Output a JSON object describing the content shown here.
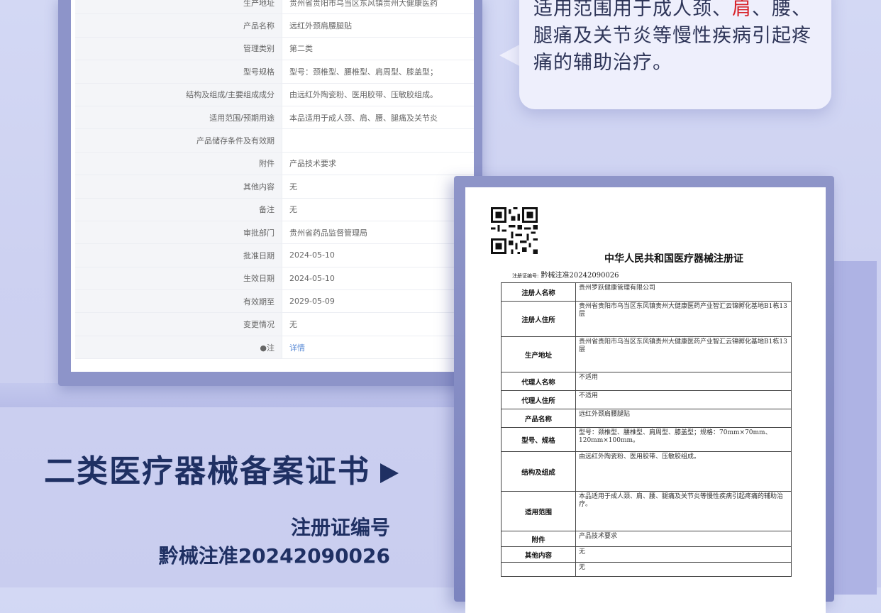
{
  "record_table": {
    "rows": [
      {
        "label": "生产地址",
        "value": "贵州省贵阳市乌当区东风镇贵州大健康医药"
      },
      {
        "label": "产品名称",
        "value": "远红外颈肩腰腿贴"
      },
      {
        "label": "管理类别",
        "value": "第二类"
      },
      {
        "label": "型号规格",
        "value": "型号：颈椎型、腰椎型、肩周型、膝盖型；"
      },
      {
        "label": "结构及组成/主要组成成分",
        "value": "由远红外陶瓷粉、医用胶带、压敏胶组成。"
      },
      {
        "label": "适用范围/预期用途",
        "value": "本品适用于成人颈、肩、腰、腿痛及关节炎"
      },
      {
        "label": "产品储存条件及有效期",
        "value": ""
      },
      {
        "label": "附件",
        "value": "产品技术要求"
      },
      {
        "label": "其他内容",
        "value": "无"
      },
      {
        "label": "备注",
        "value": "无"
      },
      {
        "label": "审批部门",
        "value": "贵州省药品监督管理局"
      },
      {
        "label": "批准日期",
        "value": "2024-05-10"
      },
      {
        "label": "生效日期",
        "value": "2024-05-10"
      },
      {
        "label": "有效期至",
        "value": "2029-05-09"
      },
      {
        "label": "变更情况",
        "value": "无"
      },
      {
        "label": "●注",
        "value": "详情",
        "link": true
      }
    ]
  },
  "bubble": {
    "part1": "适用范围用于成人颈、",
    "highlight": "肩",
    "part2": "、腰、腿痛及关节炎等慢性疾病引起疼痛的辅助治疗。",
    "highlight_color": "#d8232a"
  },
  "titles": {
    "main": "二类医疗器械备案证书",
    "sub_label": "注册证编号",
    "sub_number": "黔械注准20242090026"
  },
  "certificate": {
    "title": "中华人民共和国医疗器械注册证",
    "number_label": "注册证编号:",
    "number": "黔械注准20242090026",
    "rows": [
      {
        "label": "注册人名称",
        "value": "贵州罗跃健康管理有限公司"
      },
      {
        "label": "注册人住所",
        "value": "贵州省贵阳市乌当区东风镇贵州大健康医药产业智汇云锦孵化基地B1栋13层"
      },
      {
        "label": "生产地址",
        "value": "贵州省贵阳市乌当区东风镇贵州大健康医药产业智汇云锦孵化基地B1栋13层"
      },
      {
        "label": "代理人名称",
        "value": "不适用"
      },
      {
        "label": "代理人住所",
        "value": "不适用"
      },
      {
        "label": "产品名称",
        "value": "远红外颈肩腰腿贴"
      },
      {
        "label": "型号、规格",
        "value": "型号：颈椎型、腰椎型、肩周型、膝盖型；规格：70mm×70mm、120mm×100mm。"
      },
      {
        "label": "结构及组成",
        "value": "由远红外陶瓷粉、医用胶带、压敏胶组成。"
      },
      {
        "label": "适用范围",
        "value": "本品适用于成人颈、肩、腰、腿痛及关节炎等慢性疾病引起疼痛的辅助治疗。"
      },
      {
        "label": "附件",
        "value": "产品技术要求"
      },
      {
        "label": "其他内容",
        "value": "无"
      },
      {
        "label": "",
        "value": "无"
      }
    ]
  }
}
